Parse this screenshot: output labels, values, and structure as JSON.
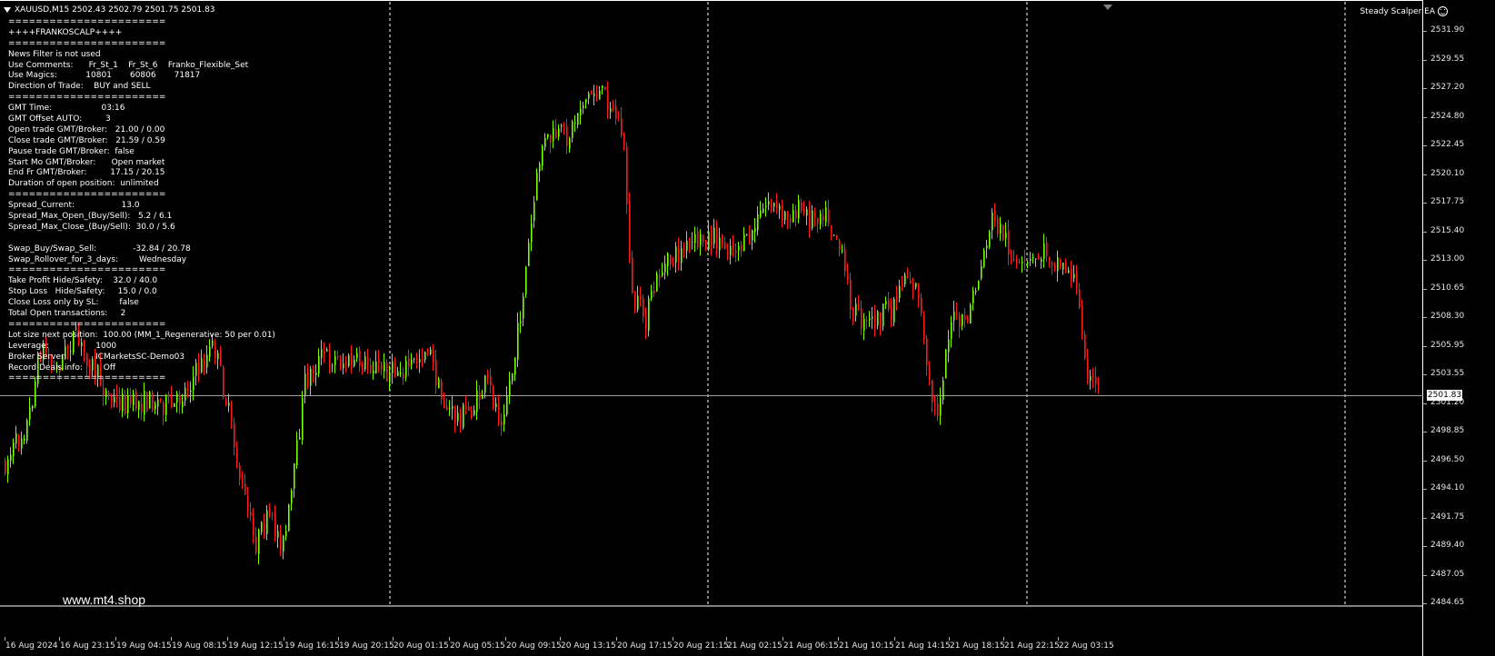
{
  "chart": {
    "symbol_line": "XAUUSD,M15  2502.43 2502.79 2501.75 2501.83",
    "ea_name": "Steady Scalper EA",
    "watermark": "www.mt4.shop",
    "current_price": "2501.83",
    "price_labels": [
      "2531.90",
      "2529.55",
      "2527.20",
      "2524.80",
      "2522.45",
      "2520.10",
      "2517.75",
      "2515.40",
      "2513.00",
      "2510.65",
      "2508.30",
      "2505.95",
      "2503.55",
      "2501.20",
      "2498.85",
      "2496.50",
      "2494.10",
      "2491.75",
      "2489.40",
      "2487.05",
      "2484.65"
    ],
    "time_labels": [
      "16 Aug 2024",
      "16 Aug 23:15",
      "19 Aug 04:15",
      "19 Aug 08:15",
      "19 Aug 12:15",
      "19 Aug 16:15",
      "19 Aug 20:15",
      "20 Aug 01:15",
      "20 Aug 05:15",
      "20 Aug 09:15",
      "20 Aug 13:15",
      "20 Aug 17:15",
      "20 Aug 21:15",
      "21 Aug 02:15",
      "21 Aug 06:15",
      "21 Aug 10:15",
      "21 Aug 14:15",
      "21 Aug 18:15",
      "21 Aug 22:15",
      "22 Aug 03:15"
    ],
    "colors": {
      "bull": "#7CFC00",
      "bear": "#ff1a1a",
      "background": "#000000",
      "grid": "#ffffff",
      "price_line": "#a0a0a0"
    }
  },
  "info_panel": [
    "=======================",
    "++++FRANKOSCALP++++",
    "=======================",
    "News Filter is not used",
    "Use Comments:      Fr_St_1    Fr_St_6    Franko_Flexible_Set",
    "Use Magics:           10801       60806       71817",
    "Direction of Trade:    BUY and SELL",
    "=======================",
    "GMT Time:                   03:16",
    "GMT Offset AUTO:         3",
    "Open trade GMT/Broker:   21.00 / 0.00",
    "Close trade GMT/Broker:   21.59 / 0.59",
    "Pause trade GMT/Broker:  false",
    "Start Mo GMT/Broker:      Open market",
    "End Fr GMT/Broker:         17.15 / 20.15",
    "Duration of open position:  unlimited",
    "=======================",
    "Spread_Current:                  13.0",
    "Spread_Max_Open_(Buy/Sell):   5.2 / 6.1",
    "Spread_Max_Close_(Buy/Sell):  30.0 / 5.6",
    "",
    "Swap_Buy/Swap_Sell:              -32.84 / 20.78",
    "Swap_Rollover_for_3_days:        Wednesday",
    "=======================",
    "Take Profit Hide/Safety:    32.0 / 40.0",
    "Stop Loss   Hide/Safety:     15.0 / 0.0",
    "Close Loss only by SL:        false",
    "Total Open transactions:     2",
    "=======================",
    "Lot size next position:  100.00 (MM_1_Regenerative: 50 per 0.01)",
    "Leverage:                  1000",
    "Broker Server:           ICMarketsSC-Demo03",
    "Record Deals info:        Off",
    "======================="
  ]
}
